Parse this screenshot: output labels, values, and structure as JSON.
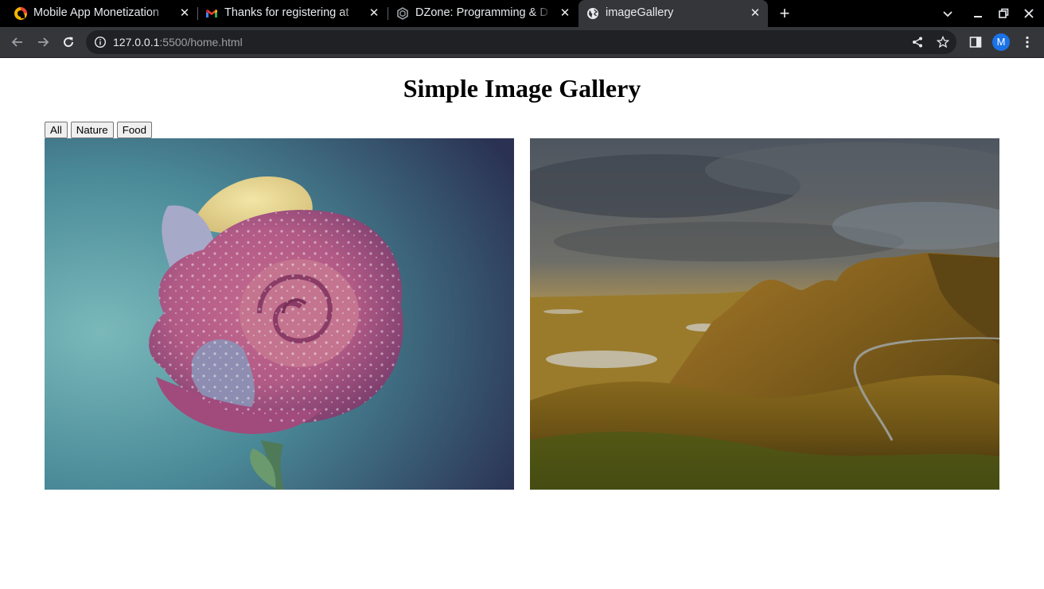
{
  "browser": {
    "tabs": [
      {
        "title": "Mobile App Monetization",
        "favicon": "app-monetization-logo-icon",
        "active": false
      },
      {
        "title": "Thanks for registering at",
        "favicon": "gmail-icon",
        "active": false
      },
      {
        "title": "DZone: Programming & D",
        "favicon": "dzone-icon",
        "active": false
      },
      {
        "title": "imageGallery",
        "favicon": "globe-icon",
        "active": true
      }
    ],
    "address": {
      "host": "127.0.0.1",
      "path": ":5500/home.html"
    },
    "profile_initial": "M",
    "colors": {
      "frame": "#000000",
      "toolbar": "#35363a",
      "omnibox": "#202124",
      "avatar": "#1a73e8"
    }
  },
  "page": {
    "title": "Simple Image Gallery",
    "filters": [
      {
        "label": "All"
      },
      {
        "label": "Nature"
      },
      {
        "label": "Food"
      }
    ],
    "images": [
      {
        "subject": "rose-with-water-drops-photo"
      },
      {
        "subject": "mountain-sunrise-landscape-photo"
      }
    ]
  }
}
